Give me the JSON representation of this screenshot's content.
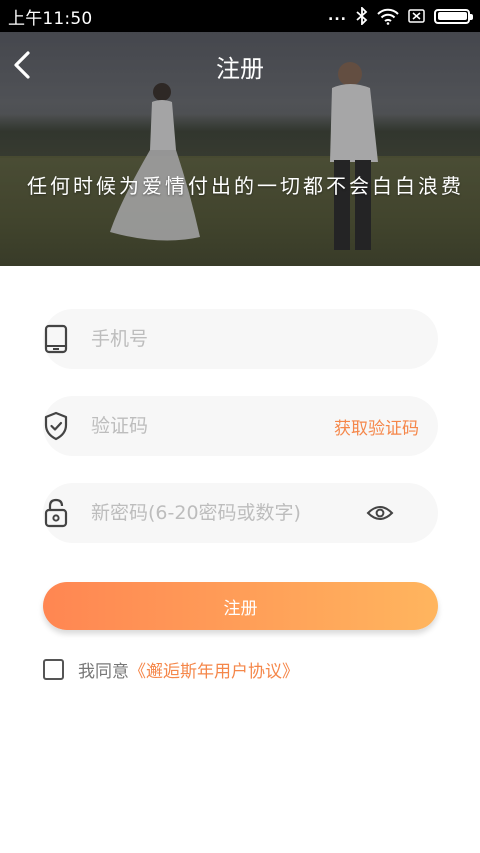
{
  "status_bar": {
    "time": "上午11:50",
    "dots": "...",
    "icons": [
      "bluetooth-icon",
      "wifi-icon",
      "sim-card-icon",
      "battery-icon"
    ]
  },
  "header": {
    "title": "注册",
    "slogan": "任何时候为爱情付出的一切都不会白白浪费"
  },
  "form": {
    "phone_placeholder": "手机号",
    "code_placeholder": "验证码",
    "get_code_label": "获取验证码",
    "password_placeholder": "新密码(6-20密码或数字)"
  },
  "actions": {
    "register_label": "注册"
  },
  "agreement": {
    "text": "我同意",
    "link": "《邂逅斯年用户协议》"
  },
  "colors": {
    "accent": "#f5874a",
    "button_gradient_start": "#ff8652",
    "button_gradient_end": "#ffb55e",
    "field_bg": "#f7f7f7"
  }
}
